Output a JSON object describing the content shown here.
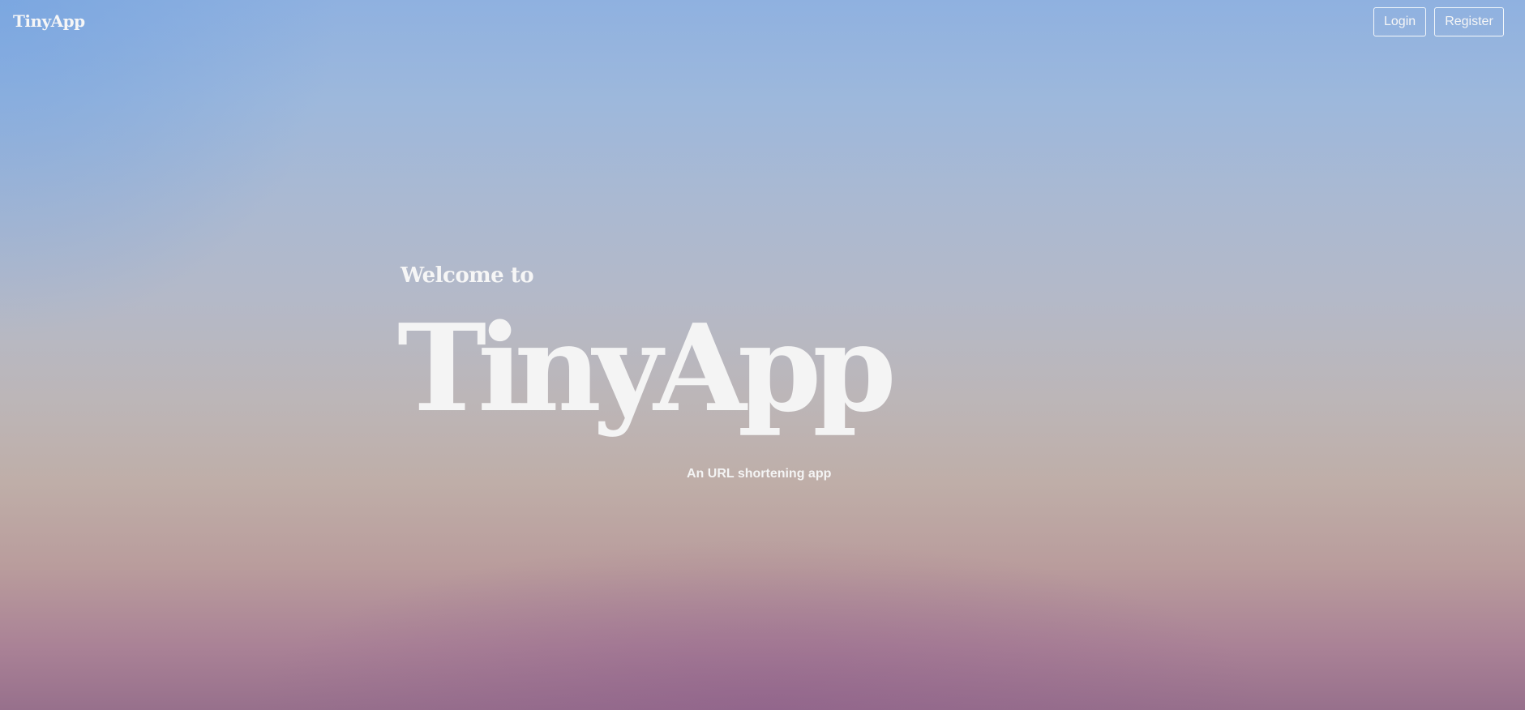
{
  "nav": {
    "brand": "TinyApp",
    "login_label": "Login",
    "register_label": "Register"
  },
  "hero": {
    "welcome": "Welcome to",
    "title": "TinyApp",
    "tagline": "An URL shortening app"
  },
  "colors": {
    "text": "#f4f4f4",
    "sky_top": "#8fb1e0",
    "sky_mid": "#bcb6b8",
    "sky_bottom": "#97708c"
  }
}
